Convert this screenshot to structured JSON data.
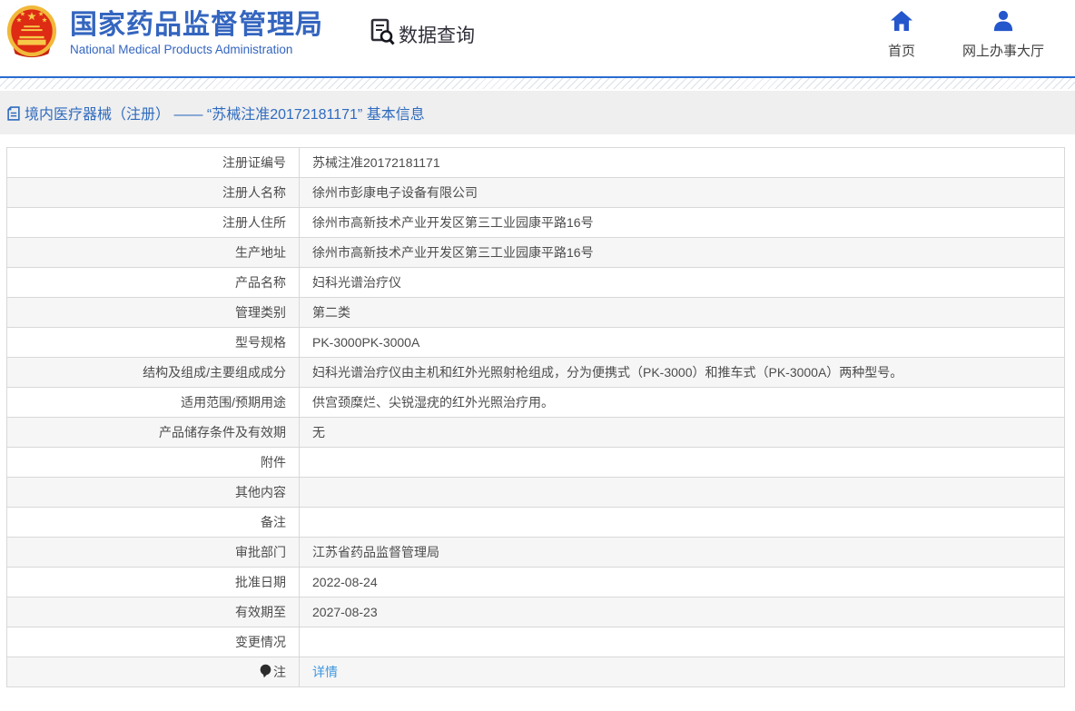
{
  "header": {
    "site_title": "国家药品监督管理局",
    "site_subtitle": "National Medical Products Administration",
    "section_title": "数据查询",
    "nav": [
      {
        "label": "首页",
        "icon": "home-icon"
      },
      {
        "label": "网上办事大厅",
        "icon": "user-icon"
      }
    ]
  },
  "breadcrumb": {
    "text": "境内医疗器械（注册） —— “苏械注准20172181171” 基本信息",
    "icon": "document-icon"
  },
  "table": {
    "rows": [
      {
        "label": "注册证编号",
        "value": "苏械注准20172181171"
      },
      {
        "label": "注册人名称",
        "value": "徐州市彭康电子设备有限公司"
      },
      {
        "label": "注册人住所",
        "value": "徐州市高新技术产业开发区第三工业园康平路16号"
      },
      {
        "label": "生产地址",
        "value": "徐州市高新技术产业开发区第三工业园康平路16号"
      },
      {
        "label": "产品名称",
        "value": "妇科光谱治疗仪"
      },
      {
        "label": "管理类别",
        "value": "第二类"
      },
      {
        "label": "型号规格",
        "value": "PK-3000PK-3000A"
      },
      {
        "label": "结构及组成/主要组成成分",
        "value": "妇科光谱治疗仪由主机和红外光照射枪组成，分为便携式（PK-3000）和推车式（PK-3000A）两种型号。"
      },
      {
        "label": "适用范围/预期用途",
        "value": "供宫颈糜烂、尖锐湿疣的红外光照治疗用。"
      },
      {
        "label": "产品储存条件及有效期",
        "value": "无"
      },
      {
        "label": "附件",
        "value": ""
      },
      {
        "label": "其他内容",
        "value": ""
      },
      {
        "label": "备注",
        "value": ""
      },
      {
        "label": "审批部门",
        "value": "江苏省药品监督管理局"
      },
      {
        "label": "批准日期",
        "value": "2022-08-24"
      },
      {
        "label": "有效期至",
        "value": "2027-08-23"
      },
      {
        "label": "变更情况",
        "value": ""
      },
      {
        "label": "注",
        "value": "详情",
        "link": true,
        "label_icon": "bulb-icon"
      }
    ]
  },
  "colors": {
    "title_blue": "#3465bf",
    "icon_blue": "#2456cc",
    "header_border_blue": "#2a6cd0",
    "breadcrumb_bg": "#efefef",
    "breadcrumb_text": "#2f6bbf",
    "row_alt_bg": "#f6f6f6",
    "table_border": "#d8d8d8",
    "link_blue": "#3e97df",
    "emblem_red": "#de2b14",
    "emblem_gold": "#f1b93a"
  }
}
